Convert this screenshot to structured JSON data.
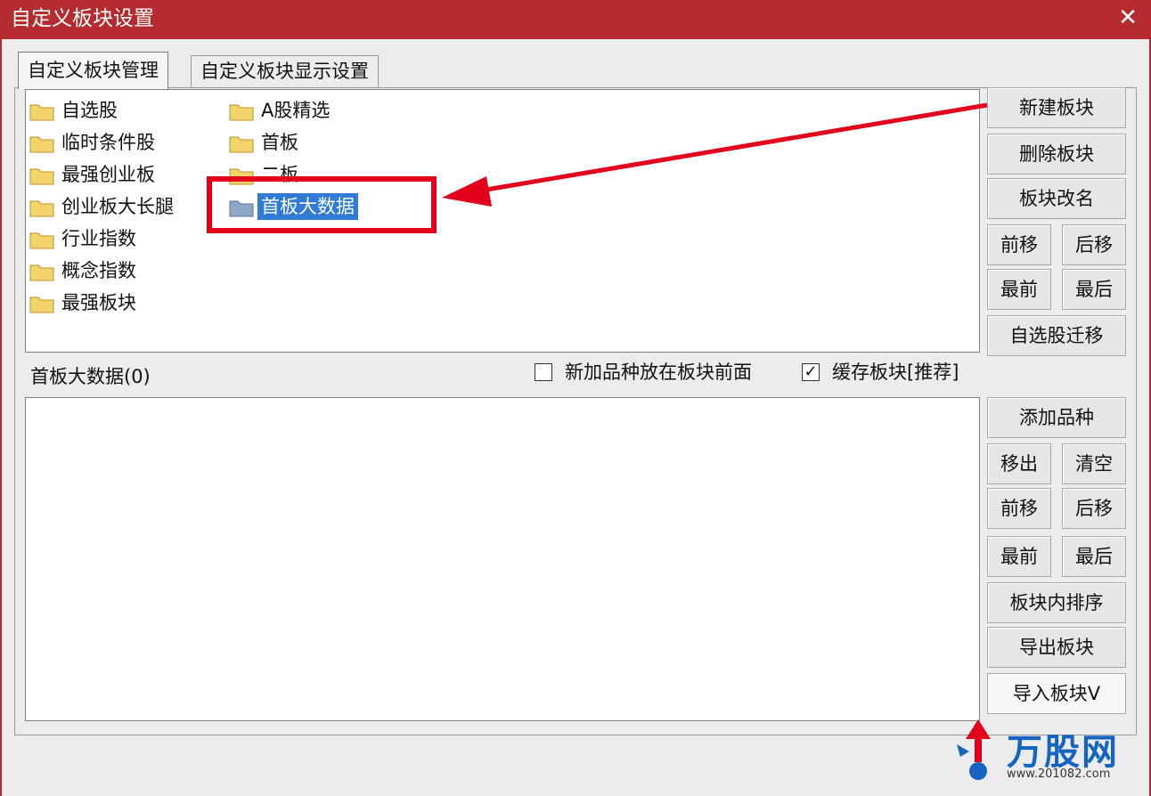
{
  "window": {
    "title": "自定义板块设置",
    "close_glyph": "✕"
  },
  "tabs": [
    {
      "label": "自定义板块管理",
      "active": true
    },
    {
      "label": "自定义板块显示设置",
      "active": false
    }
  ],
  "block_list": {
    "column1": [
      "自选股",
      "临时条件股",
      "最强创业板",
      "创业板大长腿",
      "行业指数",
      "概念指数",
      "最强板块"
    ],
    "column2": [
      "A股精选",
      "首板",
      "二板"
    ],
    "editing_item": "首板大数据"
  },
  "block_buttons": {
    "new": "新建板块",
    "delete": "删除板块",
    "rename": "板块改名",
    "move_up": "前移",
    "move_down": "后移",
    "top": "最前",
    "bottom": "最后",
    "migrate": "自选股迁移"
  },
  "stock_section": {
    "label": "首板大数据(0)",
    "option_new_front": {
      "label": "新加品种放在板块前面",
      "checked": false
    },
    "option_cache": {
      "label": "缓存板块[推荐]",
      "checked": true
    }
  },
  "stock_buttons": {
    "add": "添加品种",
    "remove": "移出",
    "clear": "清空",
    "move_up": "前移",
    "move_down": "后移",
    "top": "最前",
    "bottom": "最后",
    "sort": "板块内排序",
    "export": "导出板块",
    "import": "导入板块V"
  },
  "watermark": {
    "brand": "万股网",
    "url": "www.201082.com"
  },
  "colors": {
    "titlebar": "#b52b2f",
    "selection": "#2f7bd6",
    "highlight": "#e3001b",
    "folder": "#f3d36b"
  }
}
